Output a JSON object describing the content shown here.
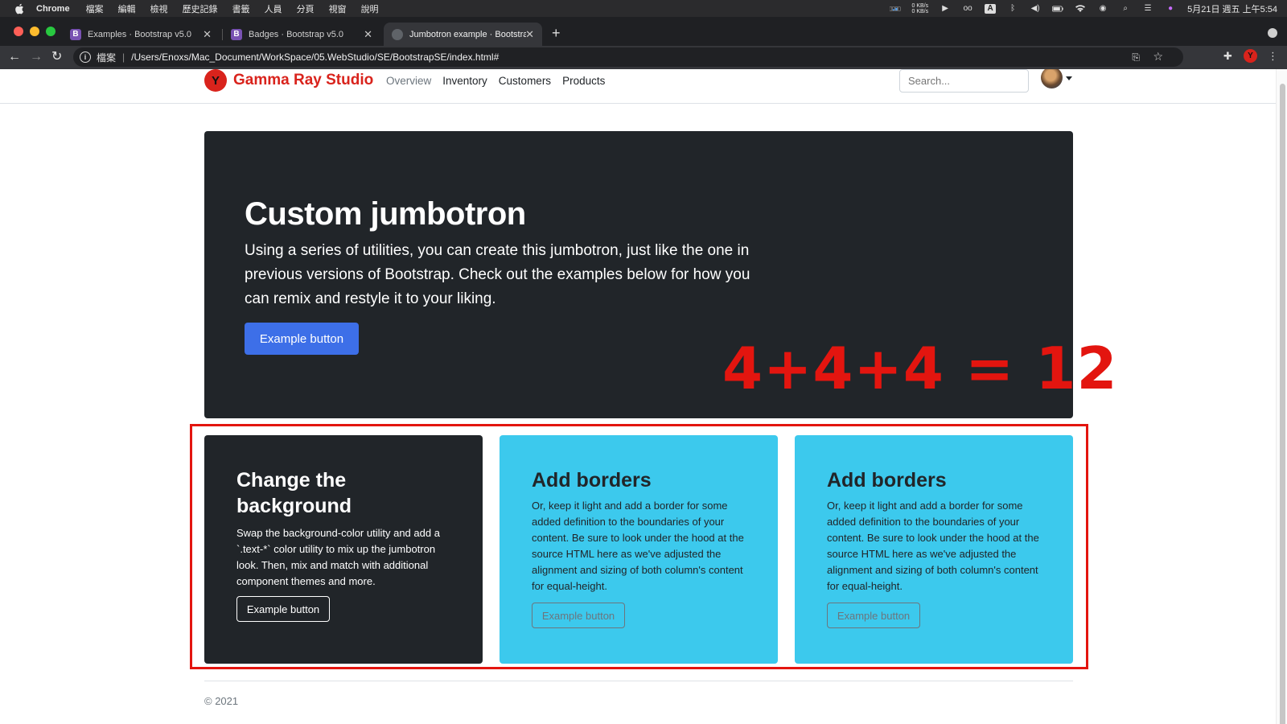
{
  "menubar": {
    "app_name": "Chrome",
    "menus": [
      "檔案",
      "編輯",
      "檢視",
      "歷史記錄",
      "書籤",
      "人員",
      "分頁",
      "視窗",
      "說明"
    ],
    "net_up": "0 KB/s",
    "net_down": "0 KB/s",
    "datetime": "5月21日 週五 上午5:54"
  },
  "tabs": [
    {
      "title": "Examples · Bootstrap v5.0",
      "favicon": "B",
      "active": false
    },
    {
      "title": "Badges · Bootstrap v5.0",
      "favicon": "B",
      "active": false
    },
    {
      "title": "Jumbotron example · Bootstrap",
      "favicon": "globe",
      "active": true
    }
  ],
  "toolbar": {
    "scheme_label": "檔案",
    "url": "/Users/Enoxs/Mac_Document/WorkSpace/05.WebStudio/SE/BootstrapSE/index.html#"
  },
  "site": {
    "brand_logo_letter": "Y",
    "brand_name": "Gamma Ray Studio",
    "nav": [
      "Overview",
      "Inventory",
      "Customers",
      "Products"
    ],
    "search_placeholder": "Search..."
  },
  "jumbotron": {
    "title": "Custom jumbotron",
    "text": "Using a series of utilities, you can create this jumbotron, just like the one in previous versions of Bootstrap. Check out the examples below for how you can remix and restyle it to your liking.",
    "button": "Example button"
  },
  "annotation": "4+4+4 = 12",
  "features": [
    {
      "title": "Change the background",
      "text": "Swap the background-color utility and add a `.text-*` color utility to mix up the jumbotron look. Then, mix and match with additional component themes and more.",
      "button": "Example button"
    },
    {
      "title": "Add borders",
      "text": "Or, keep it light and add a border for some added definition to the boundaries of your content. Be sure to look under the hood at the source HTML here as we've adjusted the alignment and sizing of both column's content for equal-height.",
      "button": "Example button"
    },
    {
      "title": "Add borders",
      "text": "Or, keep it light and add a border for some added definition to the boundaries of your content. Be sure to look under the hood at the source HTML here as we've adjusted the alignment and sizing of both column's content for equal-height.",
      "button": "Example button"
    }
  ],
  "footer": "© 2021",
  "colors": {
    "brand": "#d9231c",
    "dark": "#212529",
    "cyan": "#3cc9ed",
    "primary": "#3d6fe8",
    "annotation": "#e3150f"
  }
}
